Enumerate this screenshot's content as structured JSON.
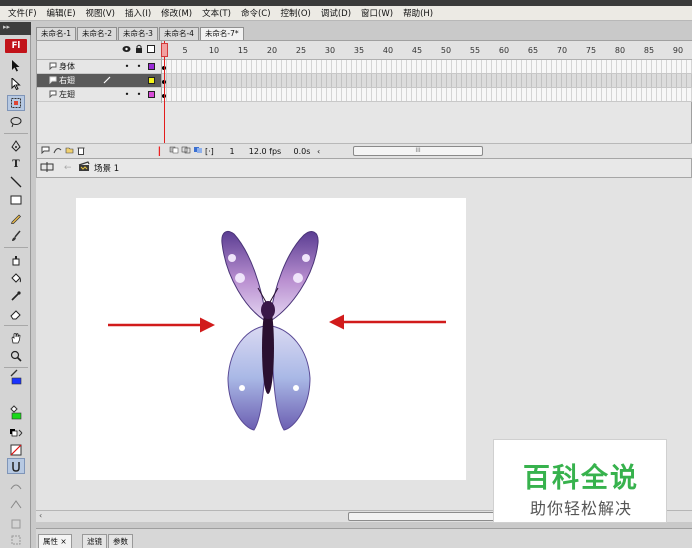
{
  "menubar": {
    "items": [
      "文件(F)",
      "编辑(E)",
      "视图(V)",
      "插入(I)",
      "修改(M)",
      "文本(T)",
      "命令(C)",
      "控制(O)",
      "调试(D)",
      "窗口(W)",
      "帮助(H)"
    ]
  },
  "toolbar": {
    "logo": "Fl",
    "grip": "▸▸",
    "colors": {
      "stroke": "#1a33ff",
      "fill": "#1ad81a",
      "brand": "#c2131a"
    }
  },
  "tabs": {
    "items": [
      "未命名-1",
      "未命名-2",
      "未命名-3",
      "未命名-4",
      "未命名-7*"
    ],
    "active_index": 4
  },
  "timeline": {
    "ruler_numbers": [
      "5",
      "10",
      "15",
      "20",
      "25",
      "30",
      "35",
      "40",
      "45",
      "50",
      "55",
      "60",
      "65",
      "70",
      "75",
      "80",
      "85",
      "90"
    ],
    "layers": [
      {
        "name": "身体",
        "color": "#9b2bd8",
        "selected": false
      },
      {
        "name": "右翅",
        "color": "#f4f41a",
        "selected": true
      },
      {
        "name": "左翅",
        "color": "#d84bd8",
        "selected": false
      }
    ],
    "frame": "1",
    "fps": "12.0 fps",
    "time": "0.0s",
    "scroll_glyph": "III"
  },
  "scene": {
    "label": "场景 1"
  },
  "stage": {
    "arrow_color": "#d11b1b"
  },
  "hscroll": {
    "glyph": "III"
  },
  "properties": {
    "tabs": [
      "属性",
      "滤镜",
      "参数"
    ],
    "close": "×"
  },
  "watermark": {
    "title": "百科全说",
    "subtitle": "助你轻松解决"
  }
}
